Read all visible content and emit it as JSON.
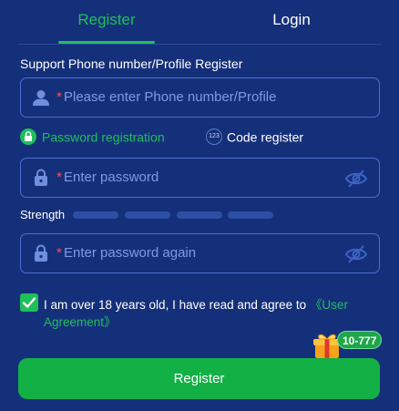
{
  "tabs": {
    "register": "Register",
    "login": "Login",
    "active": "register"
  },
  "form": {
    "section_label": "Support Phone number/Profile Register",
    "phone": {
      "required_mark": "*",
      "placeholder": "Please enter Phone number/Profile",
      "icon": "user-icon"
    },
    "modes": {
      "password_label": "Password registration",
      "code_badge": "123",
      "code_label": "Code register"
    },
    "password": {
      "required_mark": "*",
      "placeholder": "Enter password",
      "icon": "lock-icon"
    },
    "strength": {
      "label": "Strength",
      "level": 0,
      "segments": 4
    },
    "confirm_password": {
      "required_mark": "*",
      "placeholder": "Enter password again",
      "icon": "lock-icon"
    },
    "agreement": {
      "checked": true,
      "text": "I am over 18 years old, I have read and agree to ",
      "link": "《User Agreement》"
    },
    "submit_label": "Register"
  },
  "promo": {
    "badge": "10-777",
    "icon": "gift-icon"
  },
  "colors": {
    "background": "#15307a",
    "accent": "#1fbf5a",
    "placeholder": "#7b9be6",
    "required": "#ff4d5e"
  }
}
